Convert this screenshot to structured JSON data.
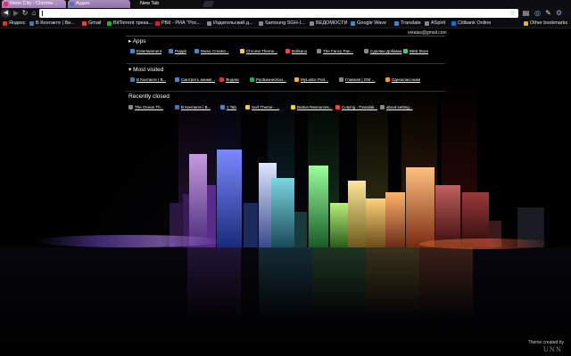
{
  "tabs": [
    {
      "title": "Neon City - Chrome ...",
      "active": false
    },
    {
      "title": "Аудио",
      "active": false
    },
    {
      "title": "New Tab",
      "active": true
    }
  ],
  "toolbar": {
    "back_icon": "back-arrow-icon",
    "forward_icon": "forward-arrow-icon",
    "reload_icon": "reload-icon",
    "home_icon": "home-icon",
    "omnibox_value": "",
    "star_icon": "star-icon"
  },
  "bookmarks": [
    {
      "label": "Яндекс",
      "color": "#d33"
    },
    {
      "label": "В Контакте | Ви...",
      "color": "#4a76a8"
    },
    {
      "label": "Gmail",
      "color": "#d44"
    },
    {
      "label": "BitTorrent трека...",
      "color": "#3a3"
    },
    {
      "label": "РБК - РИА \"Рос...",
      "color": "#c22"
    },
    {
      "label": "Издательский д...",
      "color": "#888"
    },
    {
      "label": "Samsung SGH-I...",
      "color": "#888"
    },
    {
      "label": "ВЕДОМОСТИ",
      "color": "#888"
    },
    {
      "label": "Google Wave",
      "color": "#48c"
    },
    {
      "label": "Translate",
      "color": "#48c"
    },
    {
      "label": "ASpirit",
      "color": "#888"
    },
    {
      "label": "Citibank Online",
      "color": "#07c"
    }
  ],
  "other_bookmarks": "Other bookmarks",
  "user_email": "vetalas@gmail.com",
  "sections": {
    "apps": "Apps",
    "most_visited": "Most visited",
    "recently_closed": "Recently closed"
  },
  "apps": [
    {
      "label": "Entertainment",
      "color": "#48c"
    },
    {
      "label": "Poppit",
      "color": "#48c"
    },
    {
      "label": "Music Creator...",
      "color": "#48c"
    },
    {
      "label": "Chrome Theme...",
      "color": "#fc3"
    },
    {
      "label": "Bollsano",
      "color": "#e44"
    },
    {
      "label": "The Fancy Pan...",
      "color": "#888"
    },
    {
      "label": "Сделаю Добавка",
      "color": "#888"
    },
    {
      "label": "Web Store",
      "color": "#4c8"
    }
  ],
  "most_visited": [
    {
      "label": "В Контакте | В...",
      "color": "#4a76a8"
    },
    {
      "label": "Смотреть аниме...",
      "color": "#48c"
    },
    {
      "label": "Яндекс",
      "color": "#d33"
    },
    {
      "label": "РосБизнесКон...",
      "color": "#2a5"
    },
    {
      "label": "MyLastic Port...",
      "color": "#fa3"
    },
    {
      "label": "Главная | GW ...",
      "color": "#888"
    },
    {
      "label": "Одноклассники",
      "color": "#f90"
    }
  ],
  "recently_closed": [
    {
      "label": "The Ocean Th...",
      "color": "#888"
    },
    {
      "label": "В Контакте | В...",
      "color": "#4a76a8"
    },
    {
      "label": "1 Tab",
      "color": "#48c"
    },
    {
      "label": "Surf Theme - ...",
      "color": "#fc3"
    },
    {
      "label": "Button Resources...",
      "color": "#fc3"
    },
    {
      "label": "Сutying - Translati...",
      "color": "#e44"
    },
    {
      "label": "about:setting...",
      "color": "#888"
    }
  ],
  "theme_credit": "Theme created by",
  "theme_logo": "UNN"
}
